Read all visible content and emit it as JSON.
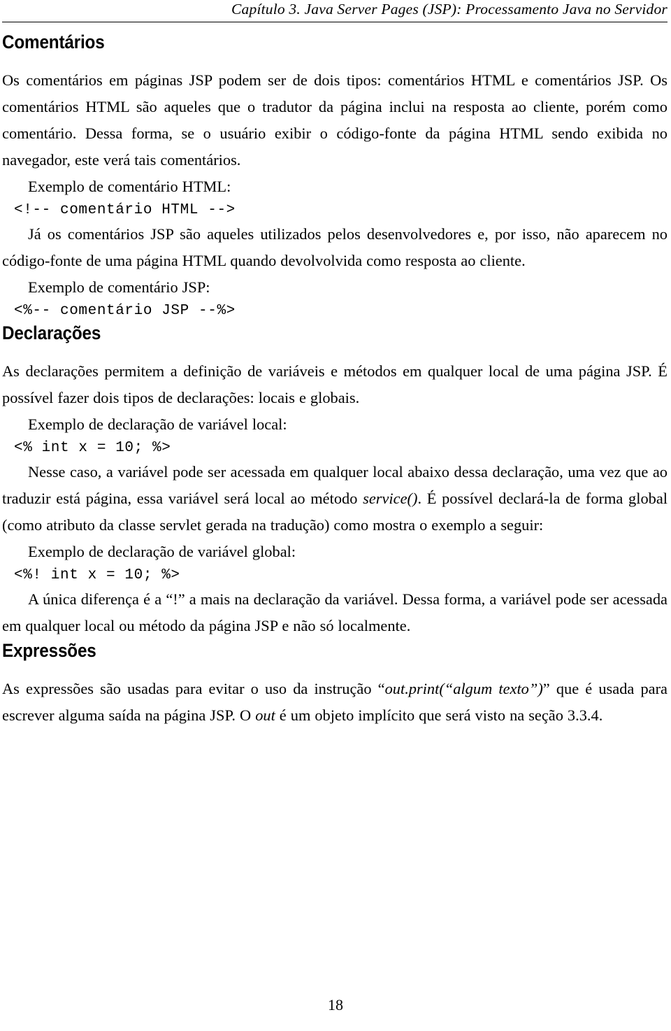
{
  "header": {
    "running_title": "Capítulo 3. Java Server Pages (JSP): Processamento Java no Servidor"
  },
  "footer": {
    "page_number": "18"
  },
  "sections": [
    {
      "heading": "Comentários",
      "paragraphs": [
        "Os comentários em páginas JSP podem ser de dois tipos: comentários HTML e comentários JSP. Os comentários HTML são aqueles que o tradutor da página inclui na resposta ao cliente, porém como comentário. Dessa forma, se o usuário exibir o código-fonte da página HTML sendo exibida no navegador, este verá tais comentários.",
        "Exemplo de comentário HTML:",
        "Já os comentários JSP são aqueles utilizados pelos desenvolvedores e, por isso, não aparecem no código-fonte de uma página HTML quando devolvolvida como resposta ao cliente.",
        "Exemplo de comentário JSP:"
      ],
      "code": {
        "html_comment": "<!-- comentário HTML -->",
        "jsp_comment": "<%-- comentário JSP --%>"
      }
    },
    {
      "heading": "Declarações",
      "paragraphs": [
        "As declarações permitem a definição de variáveis e métodos em qualquer local de uma página JSP. É possível fazer dois tipos de declarações: locais e globais.",
        "Exemplo de declaração de variável local:",
        "Exemplo de declaração de variável global:"
      ],
      "nesse_caso": {
        "part1": "Nesse caso, a variável pode ser acessada em qualquer local abaixo dessa declaração, uma vez que ao traduzir está página, essa variável será local ao método ",
        "italic": "service()",
        "part2": ". É possível declará-la de forma global (como atributo da classe servlet gerada na tradução) como mostra o exemplo a seguir:"
      },
      "unica_diferenca": {
        "part1": "A única diferença é a “!” a mais na declaração da variável. Dessa forma, a variável pode ser acessada em qualquer local ou método da página JSP e não só localmente."
      },
      "code": {
        "local_decl": "<% int x = 10; %>",
        "global_decl": "<%! int x = 10; %>"
      }
    },
    {
      "heading": "Expressões",
      "expressoes": {
        "part1": "As expressões são usadas para evitar o uso da instrução “",
        "italic1": "out.print(“algum texto”)",
        "part2": "” que é usada para escrever alguma saída na página JSP. O ",
        "italic2": "out",
        "part3": " é um objeto implícito que será visto na seção 3.3.4."
      }
    }
  ]
}
